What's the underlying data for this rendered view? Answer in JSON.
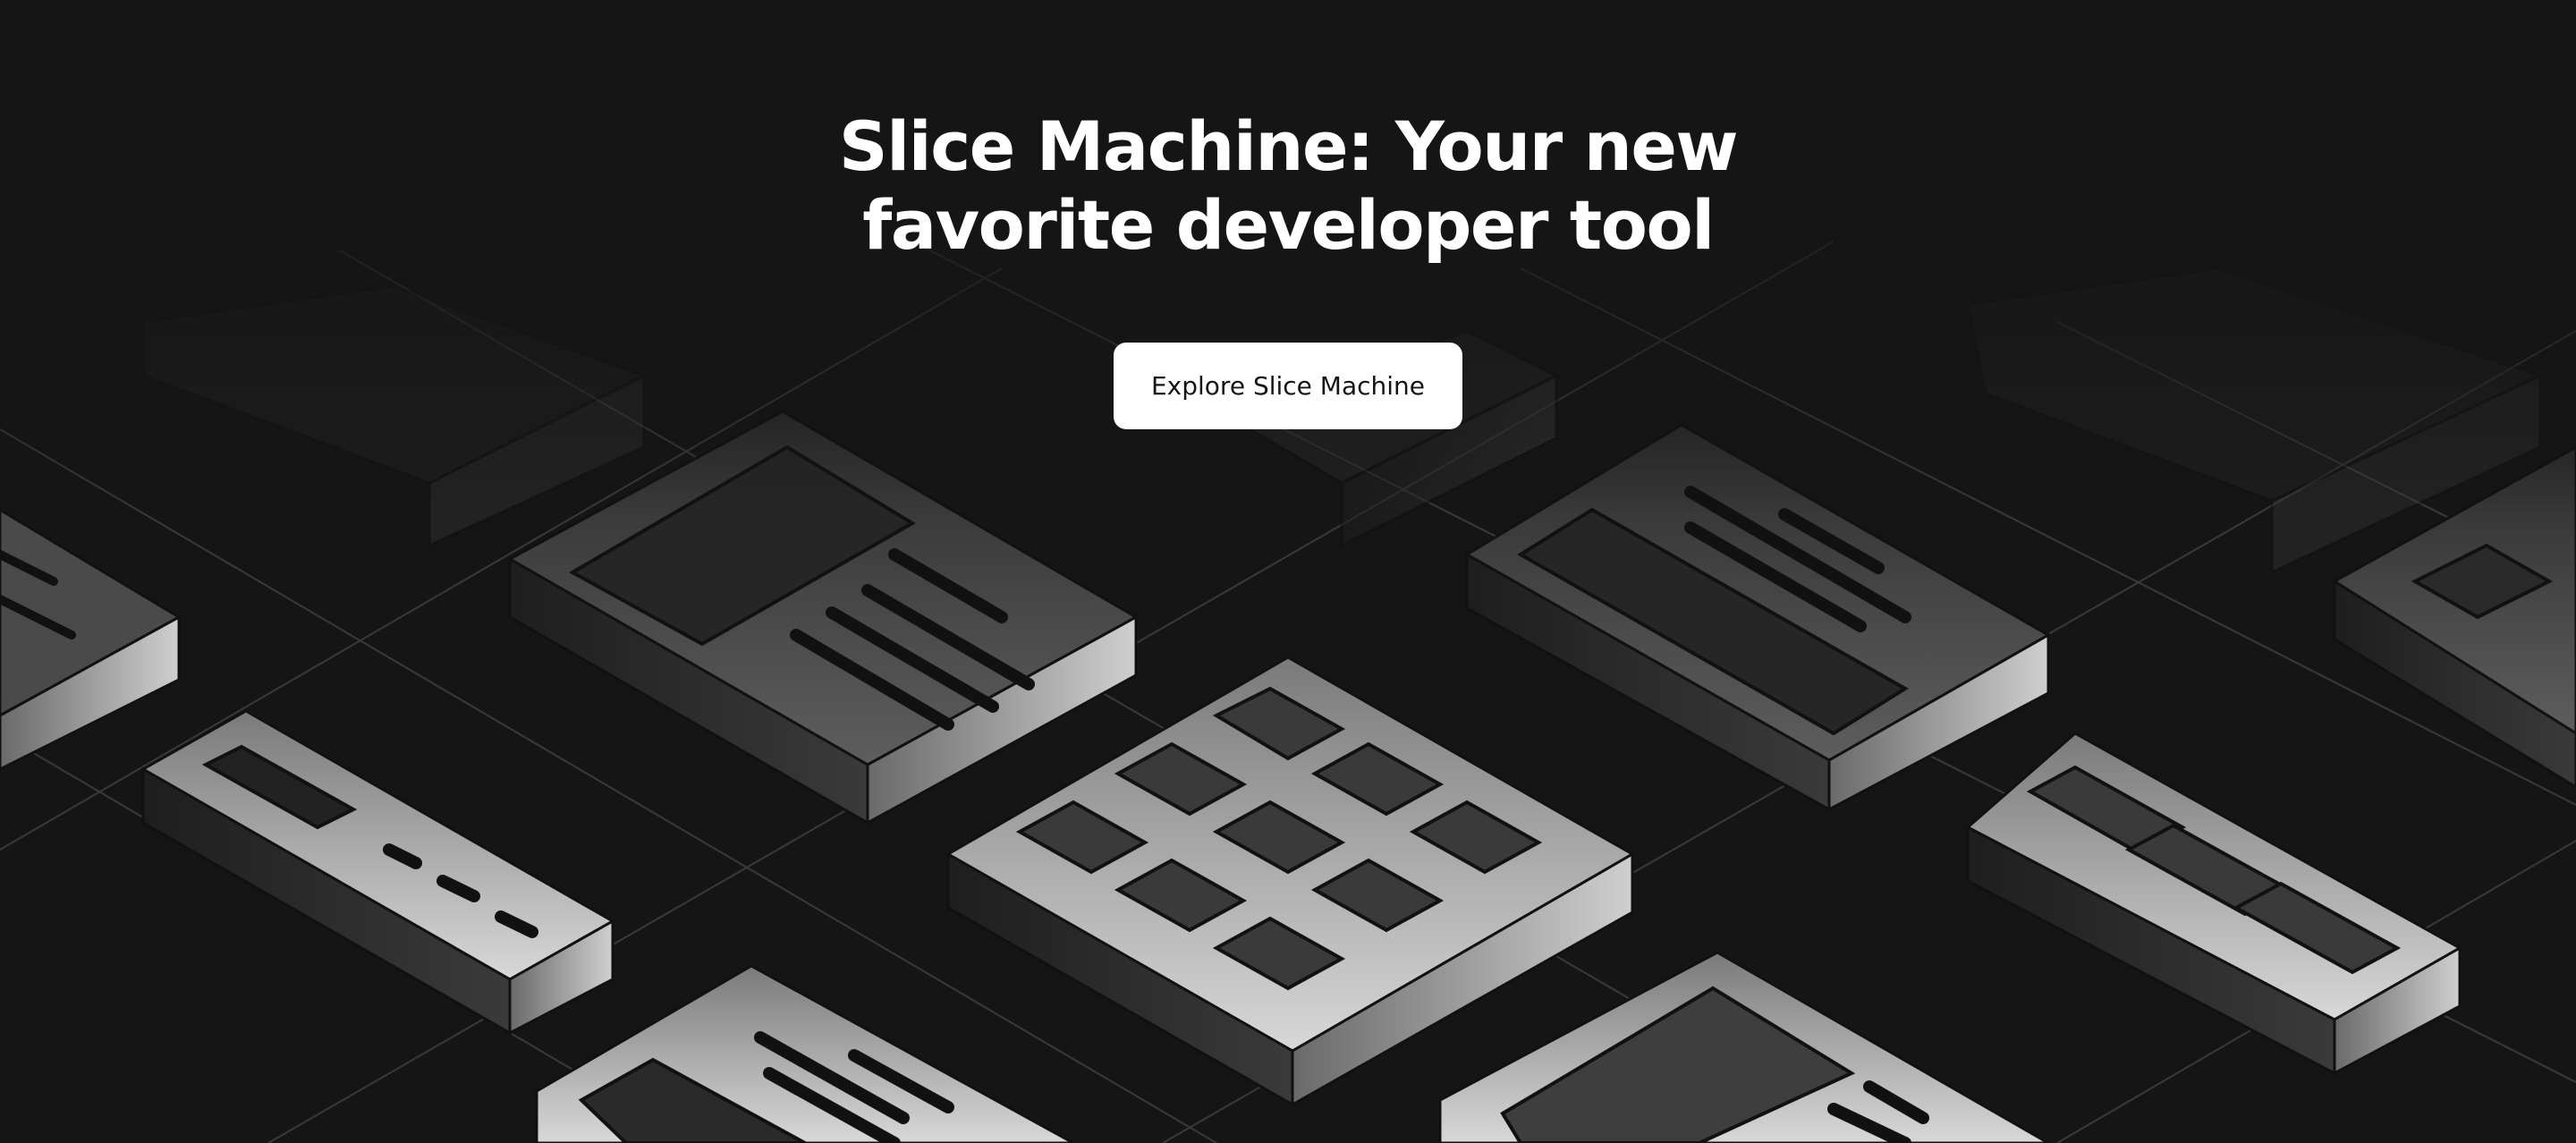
{
  "hero": {
    "title_line1": "Slice Machine: Your new",
    "title_line2": "favorite developer tool",
    "cta_label": "Explore Slice Machine"
  },
  "colors": {
    "background": "#151515",
    "text": "#ffffff",
    "button_bg": "#ffffff",
    "button_text": "#151515"
  },
  "illustration": {
    "description_icon": "isometric-slice-blocks-illustration"
  }
}
